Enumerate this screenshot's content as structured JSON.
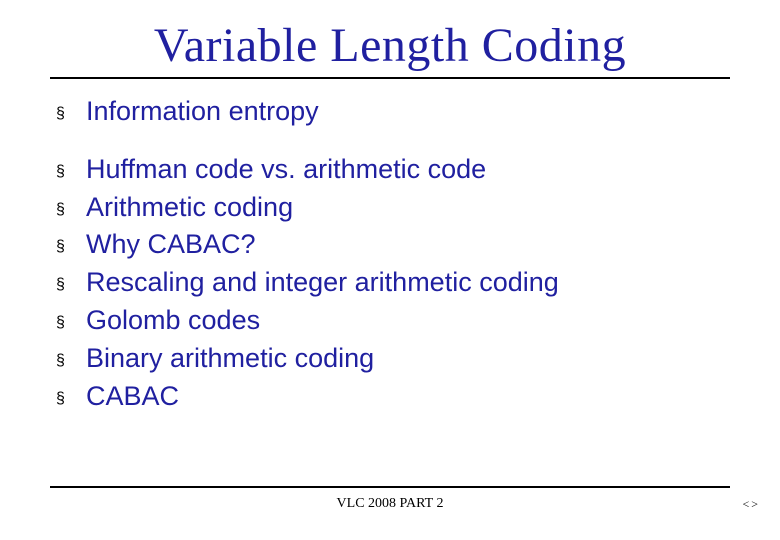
{
  "title": "Variable Length Coding",
  "groups": [
    {
      "items": [
        "Information entropy"
      ]
    },
    {
      "items": [
        "Huffman code vs. arithmetic code",
        "Arithmetic coding",
        "Why CABAC?",
        "Rescaling and integer arithmetic coding",
        "Golomb codes",
        "Binary arithmetic coding",
        "CABAC"
      ]
    }
  ],
  "footer": "VLC 2008 PART 2",
  "nav_symbol": "<>",
  "bullet_char": "§"
}
